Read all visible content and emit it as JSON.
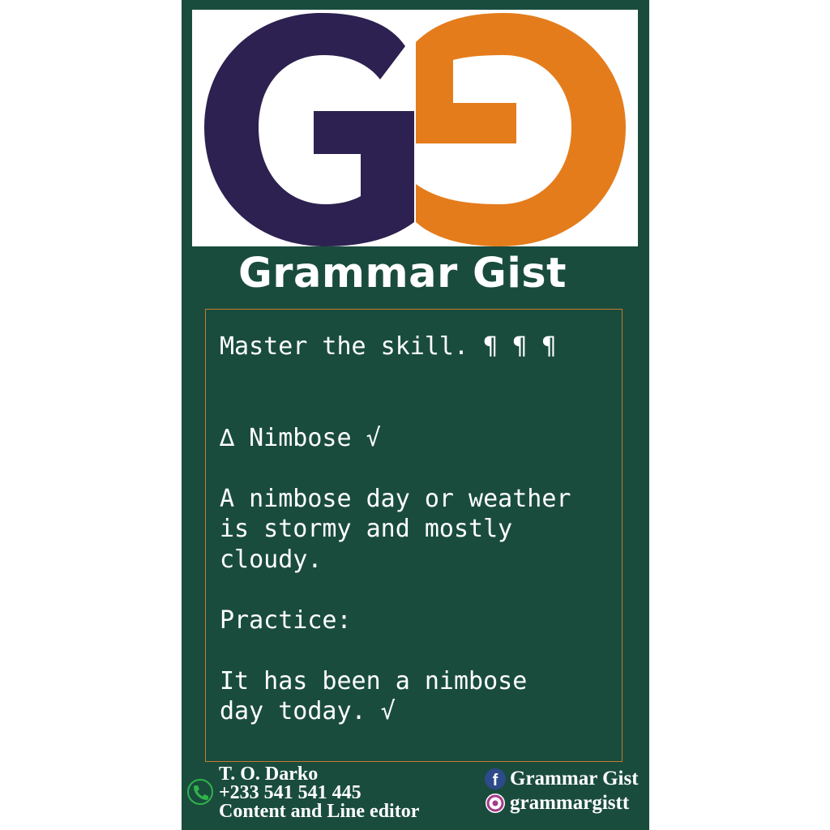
{
  "brand": {
    "name": "Grammar Gist",
    "logo_icon": "gg-logo",
    "colors": {
      "background": "#1a4c3e",
      "logo_purple": "#2c2150",
      "logo_orange": "#e47c1c",
      "frame": "#c57a2a"
    }
  },
  "post": {
    "lines": [
      "Master the skill. ¶ ¶ ¶",
      "",
      "",
      "∆ Nimbose √",
      "",
      "A nimbose day or weather",
      "is stormy and mostly",
      "cloudy.",
      "",
      "Practice:",
      "",
      "It has been a nimbose",
      "day today. √"
    ]
  },
  "footer": {
    "author": "T. O. Darko",
    "phone": "+233 541 541 445",
    "role": "Content and Line editor",
    "phone_icon": "phone-icon",
    "facebook": {
      "icon": "facebook-icon",
      "label": "Grammar Gist"
    },
    "instagram": {
      "icon": "instagram-icon",
      "label": "grammargistt"
    }
  }
}
